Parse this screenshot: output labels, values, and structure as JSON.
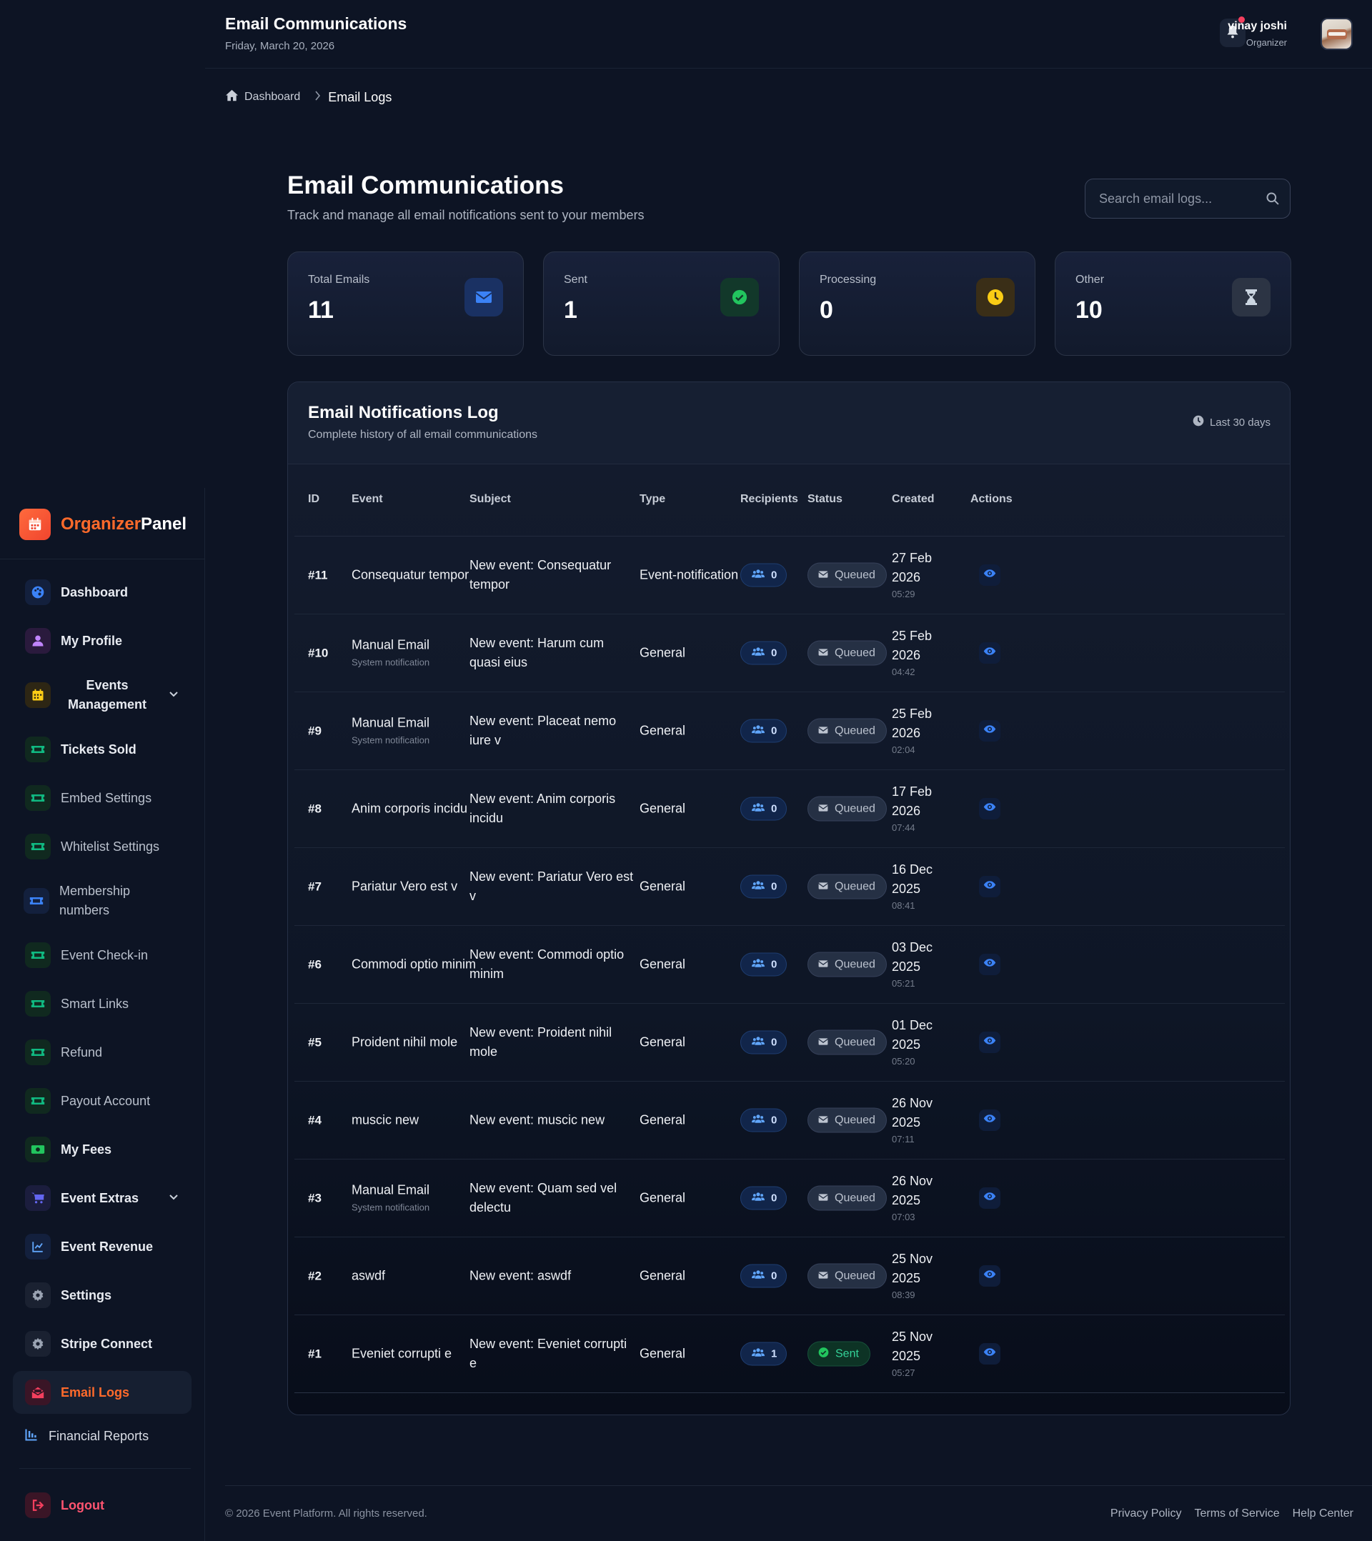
{
  "topbar": {
    "title": "Email Communications",
    "date": "Friday, March 20, 2026",
    "user_name": "vinay joshi",
    "user_role": "Organizer"
  },
  "brand": {
    "name_part1": "Organizer",
    "name_part2": "Panel",
    "accent_color": "#ff6a2b"
  },
  "sidebar": {
    "items": [
      {
        "label": "Dashboard",
        "icon": "palette-icon"
      },
      {
        "label": "My Profile",
        "icon": "user-icon"
      },
      {
        "label": "Events Management",
        "icon": "calendar-icon"
      },
      {
        "label": "Tickets Sold",
        "icon": "ticket-icon"
      },
      {
        "label": "Embed Settings",
        "icon": "ticket-icon"
      },
      {
        "label": "Whitelist Settings",
        "icon": "ticket-icon"
      },
      {
        "label": "Membership numbers",
        "icon": "id-card-icon"
      },
      {
        "label": "Event Check-in",
        "icon": "ticket-icon"
      },
      {
        "label": "Smart Links",
        "icon": "ticket-icon"
      },
      {
        "label": "Refund",
        "icon": "ticket-icon"
      },
      {
        "label": "Payout Account",
        "icon": "ticket-icon"
      },
      {
        "label": "My Fees",
        "icon": "money-icon"
      },
      {
        "label": "Event Extras",
        "icon": "cart-icon"
      },
      {
        "label": "Event Revenue",
        "icon": "line-chart-icon"
      },
      {
        "label": "Settings",
        "icon": "gear-icon"
      },
      {
        "label": "Stripe Connect",
        "icon": "gear-icon"
      },
      {
        "label": "Email Logs",
        "icon": "envelope-open-icon"
      },
      {
        "label": "Financial Reports",
        "icon": "bar-chart-icon"
      }
    ],
    "logout_label": "Logout"
  },
  "breadcrumb": {
    "home": "Dashboard",
    "current": "Email Logs"
  },
  "page": {
    "title": "Email Communications",
    "subtitle": "Track and manage all email notifications sent to your members"
  },
  "search": {
    "placeholder": "Search email logs...",
    "value": ""
  },
  "stats": [
    {
      "label": "Total Emails",
      "value": "11",
      "icon": "envelope-icon",
      "color": "#3b82f6"
    },
    {
      "label": "Sent",
      "value": "1",
      "icon": "check-circle-icon",
      "color": "#22c55e"
    },
    {
      "label": "Processing",
      "value": "0",
      "icon": "clock-icon",
      "color": "#facc15"
    },
    {
      "label": "Other",
      "value": "10",
      "icon": "hourglass-icon",
      "color": "#cbd5e1"
    }
  ],
  "log": {
    "title": "Email Notifications Log",
    "subtitle": "Complete history of all email communications",
    "range": "Last 30 days",
    "columns": [
      "ID",
      "Event",
      "Subject",
      "Type",
      "Recipients",
      "Status",
      "Created",
      "Actions"
    ],
    "rows": [
      {
        "id": "#11",
        "event": "Consequatur tempor",
        "event_sub": "",
        "subject": "New event: Consequatur tempor",
        "type": "Event-notification",
        "recipients": "0",
        "status": "Queued",
        "created_date": "27 Feb 2026",
        "created_time": "05:29"
      },
      {
        "id": "#10",
        "event": "Manual Email",
        "event_sub": "System notification",
        "subject": "New event: Harum cum quasi eius",
        "type": "General",
        "recipients": "0",
        "status": "Queued",
        "created_date": "25 Feb 2026",
        "created_time": "04:42"
      },
      {
        "id": "#9",
        "event": "Manual Email",
        "event_sub": "System notification",
        "subject": "New event: Placeat nemo iure v",
        "type": "General",
        "recipients": "0",
        "status": "Queued",
        "created_date": "25 Feb 2026",
        "created_time": "02:04"
      },
      {
        "id": "#8",
        "event": "Anim corporis incidu",
        "event_sub": "",
        "subject": "New event: Anim corporis incidu",
        "type": "General",
        "recipients": "0",
        "status": "Queued",
        "created_date": "17 Feb 2026",
        "created_time": "07:44"
      },
      {
        "id": "#7",
        "event": "Pariatur Vero est v",
        "event_sub": "",
        "subject": "New event: Pariatur Vero est v",
        "type": "General",
        "recipients": "0",
        "status": "Queued",
        "created_date": "16 Dec 2025",
        "created_time": "08:41"
      },
      {
        "id": "#6",
        "event": "Commodi optio minim",
        "event_sub": "",
        "subject": "New event: Commodi optio minim",
        "type": "General",
        "recipients": "0",
        "status": "Queued",
        "created_date": "03 Dec 2025",
        "created_time": "05:21"
      },
      {
        "id": "#5",
        "event": "Proident nihil mole",
        "event_sub": "",
        "subject": "New event: Proident nihil mole",
        "type": "General",
        "recipients": "0",
        "status": "Queued",
        "created_date": "01 Dec 2025",
        "created_time": "05:20"
      },
      {
        "id": "#4",
        "event": "muscic new",
        "event_sub": "",
        "subject": "New event: muscic new",
        "type": "General",
        "recipients": "0",
        "status": "Queued",
        "created_date": "26 Nov 2025",
        "created_time": "07:11"
      },
      {
        "id": "#3",
        "event": "Manual Email",
        "event_sub": "System notification",
        "subject": "New event: Quam sed vel delectu",
        "type": "General",
        "recipients": "0",
        "status": "Queued",
        "created_date": "26 Nov 2025",
        "created_time": "07:03"
      },
      {
        "id": "#2",
        "event": "aswdf",
        "event_sub": "",
        "subject": "New event: aswdf",
        "type": "General",
        "recipients": "0",
        "status": "Queued",
        "created_date": "25 Nov 2025",
        "created_time": "08:39"
      },
      {
        "id": "#1",
        "event": "Eveniet corrupti e",
        "event_sub": "",
        "subject": "New event: Eveniet corrupti e",
        "type": "General",
        "recipients": "1",
        "status": "Sent",
        "created_date": "25 Nov 2025",
        "created_time": "05:27"
      }
    ]
  },
  "footer": {
    "copyright": "© 2026 Event Platform. All rights reserved.",
    "links": [
      "Privacy Policy",
      "Terms of Service",
      "Help Center"
    ]
  }
}
